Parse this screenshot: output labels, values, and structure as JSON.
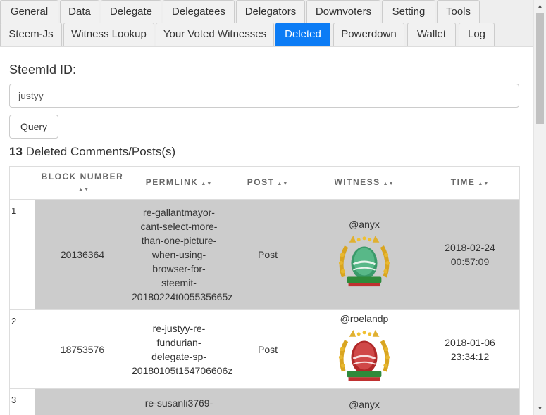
{
  "tabs_row1": [
    {
      "label": "General"
    },
    {
      "label": "Data"
    },
    {
      "label": "Delegate"
    },
    {
      "label": "Delegatees"
    },
    {
      "label": "Delegators"
    },
    {
      "label": "Downvoters"
    },
    {
      "label": "Setting"
    },
    {
      "label": "Tools"
    }
  ],
  "tabs_row2": [
    {
      "label": "Steem-Js"
    },
    {
      "label": "Witness Lookup"
    },
    {
      "label": "Your Voted Witnesses"
    },
    {
      "label": "Deleted",
      "active": true
    },
    {
      "label": "Powerdown"
    },
    {
      "label": "Wallet"
    },
    {
      "label": "Log"
    }
  ],
  "form": {
    "label": "SteemId ID:",
    "value": "justyy",
    "button": "Query"
  },
  "summary": {
    "count": "13",
    "text": " Deleted Comments/Posts(s)"
  },
  "table": {
    "headers": {
      "block": "BLOCK NUMBER",
      "permlink": "PERMLINK",
      "post": "POST",
      "witness": "WITNESS",
      "time": "TIME"
    },
    "rows": [
      {
        "index": "1",
        "block": "20136364",
        "permlink_lines": [
          "re-gallantmayor-",
          "cant-select-more-",
          "than-one-picture-",
          "when-using-",
          "browser-for-",
          "steemit-",
          "20180224t005535665z"
        ],
        "post": "Post",
        "witness": "@anyx",
        "time_lines": [
          "2018-02-24",
          "00:57:09"
        ],
        "badge_icon": "green-egg-witness-badge-icon"
      },
      {
        "index": "2",
        "block": "18753576",
        "permlink_lines": [
          "re-justyy-re-",
          "fundurian-",
          "delegate-sp-",
          "20180105t154706606z"
        ],
        "post": "Post",
        "witness": "@roelandp",
        "time_lines": [
          "2018-01-06",
          "23:34:12"
        ],
        "badge_icon": "red-egg-witness-badge-icon"
      },
      {
        "index": "3",
        "permlink_first": "re-susanli3769-",
        "witness": "@anyx"
      }
    ]
  },
  "colors": {
    "active_tab": "#0c7cf5",
    "gray_row": "#cccccc"
  }
}
